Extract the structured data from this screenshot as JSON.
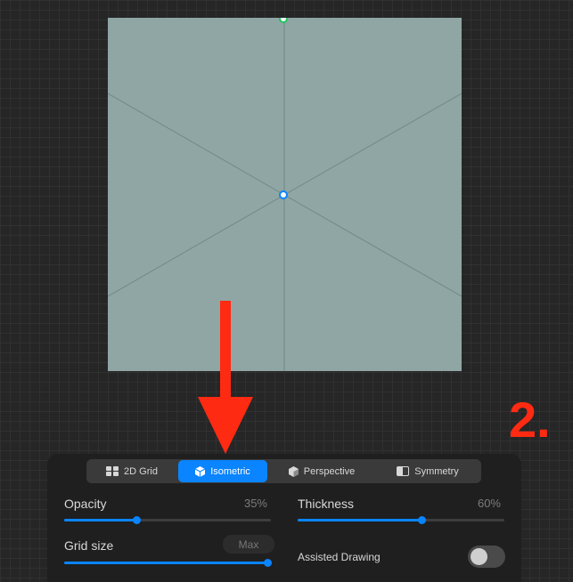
{
  "step": {
    "label": "2."
  },
  "tabs": [
    {
      "label": "2D Grid",
      "icon": "grid-2d-icon",
      "active": false
    },
    {
      "label": "Isometric",
      "icon": "isometric-cube-icon",
      "active": true
    },
    {
      "label": "Perspective",
      "icon": "perspective-cube-icon",
      "active": false
    },
    {
      "label": "Symmetry",
      "icon": "symmetry-icon",
      "active": false
    }
  ],
  "opacity": {
    "label": "Opacity",
    "value": "35%",
    "level": 0.35
  },
  "thickness": {
    "label": "Thickness",
    "value": "60%",
    "level": 0.6
  },
  "grid_size": {
    "label": "Grid size",
    "value": "Max",
    "level": 1.0
  },
  "assisted_drawing": {
    "label": "Assisted Drawing",
    "enabled": false
  },
  "colors": {
    "accent": "#0a84ff",
    "arrow": "#ff2a12",
    "canvas": "#8fa6a4",
    "top_handle": "#22c55e",
    "center_handle": "#0a84ff"
  }
}
